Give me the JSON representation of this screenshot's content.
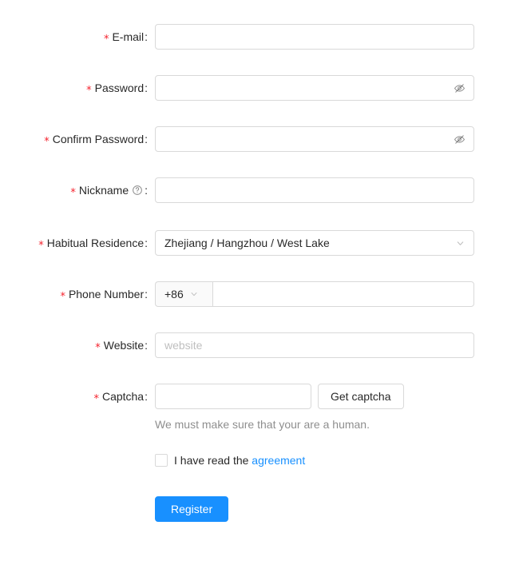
{
  "theme": {
    "primary_color": "#1890ff",
    "required_mark_color": "#f5222d",
    "link_color": "#1890ff",
    "border_color": "#d9d9d9",
    "label_color": "rgba(0,0,0,0.85)",
    "placeholder_color": "#bfbfbf",
    "addon_bg": "#fafafa"
  },
  "form": {
    "colon": ":",
    "required_mark": "*",
    "fields": {
      "email": {
        "label": "E-mail",
        "required": true,
        "value": "",
        "placeholder": ""
      },
      "password": {
        "label": "Password",
        "required": true,
        "value": "",
        "placeholder": "",
        "suffix_icon": "eye-invisible-icon"
      },
      "confirm_password": {
        "label": "Confirm Password",
        "required": true,
        "value": "",
        "placeholder": "",
        "suffix_icon": "eye-invisible-icon"
      },
      "nickname": {
        "label": "Nickname",
        "required": true,
        "value": "",
        "placeholder": "",
        "tooltip_icon": "question-circle-icon"
      },
      "residence": {
        "label": "Habitual Residence",
        "required": true,
        "value": "Zhejiang / Hangzhou / West Lake",
        "suffix_icon": "chevron-down-icon"
      },
      "phone": {
        "label": "Phone Number",
        "required": true,
        "prefix": "+86",
        "prefix_icon": "chevron-down-icon",
        "value": "",
        "placeholder": ""
      },
      "website": {
        "label": "Website",
        "required": true,
        "value": "",
        "placeholder": "website"
      },
      "captcha": {
        "label": "Captcha",
        "required": true,
        "value": "",
        "placeholder": "",
        "button_label": "Get captcha",
        "help_text": "We must make sure that your are a human."
      }
    },
    "agreement": {
      "checked": false,
      "text": "I have read the",
      "link_text": "agreement"
    },
    "submit": {
      "label": "Register"
    }
  }
}
